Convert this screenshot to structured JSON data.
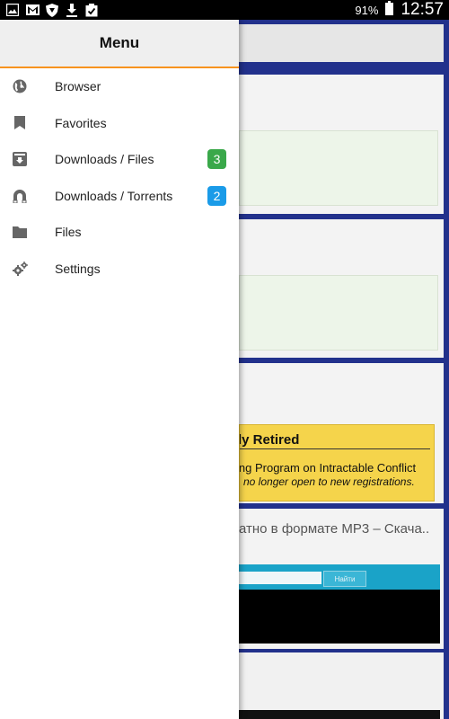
{
  "status_bar": {
    "icons": [
      "gallery-icon",
      "gmail-icon",
      "shield-icon",
      "download-icon",
      "clipboard-check-icon"
    ],
    "battery_text": "91%",
    "time": "12:57"
  },
  "drawer": {
    "title": "Menu",
    "accent_color": "#f7931e",
    "items": [
      {
        "label": "Browser",
        "icon": "globe-icon"
      },
      {
        "label": "Favorites",
        "icon": "bookmark-icon"
      },
      {
        "label": "Downloads / Files",
        "icon": "download-box-icon",
        "badge": "3",
        "badge_color": "#3aa84a"
      },
      {
        "label": "Downloads / Torrents",
        "icon": "magnet-icon",
        "badge": "2",
        "badge_color": "#1a9be8"
      },
      {
        "label": "Files",
        "icon": "folder-icon"
      },
      {
        "label": "Settings",
        "icon": "gears-icon"
      }
    ]
  },
  "background": {
    "retired_title": "ly Retired",
    "retired_line1": "ing Program on Intractable Conflict",
    "retired_line2": "no longer open to new registrations.",
    "ru_text": "атно в формате MP3 – Скача..",
    "search_button": "Найти"
  }
}
